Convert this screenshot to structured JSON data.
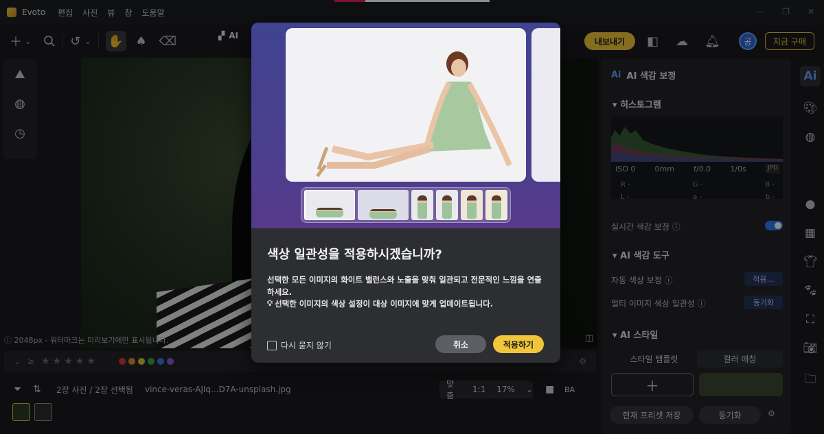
{
  "app": {
    "name": "Evoto",
    "menu": [
      "편집",
      "사진",
      "뷰",
      "창",
      "도움말"
    ]
  },
  "toolbar": {
    "ai_label": "AI",
    "export_label": "내보내기",
    "avatar_initial": "공",
    "buy_label": "지금 구매"
  },
  "canvas": {
    "watermark_info": "ⓘ 2048px - 워터마크는 미리보기에만 표시됩니다."
  },
  "filmbar": {
    "rating_op": "≥",
    "stars": "★★★★★",
    "color_dots": [
      "#d23a3a",
      "#e08a2a",
      "#d8c83a",
      "#3aa84a",
      "#3a7ad8",
      "#8a5ad8"
    ],
    "count": "2장 사진 / 2장 선택됨",
    "filename": "vince-veras-AJIq...D7A-unsplash.jpg",
    "fit_label": "맞춤",
    "ratio_label": "1:1",
    "zoom_label": "17%"
  },
  "panel": {
    "title": "AI 색감 보정",
    "histogram": {
      "title": "히스토그램",
      "iso": "ISO 0",
      "mm": "0mm",
      "f": "f/0.0",
      "shutter": "1/0s",
      "format": "JPG",
      "r": "R -",
      "g": "G -",
      "b": "B -",
      "l": "L -",
      "a": "a -",
      "b2": "b -"
    },
    "realtime_label": "실시간 색감 보정 ⓘ",
    "tools_title": "AI 색감 도구",
    "auto_label": "자동 색상 보정 ⓘ",
    "auto_btn": "적용…",
    "multi_label": "멀티 이미지 색상 일관성 ⓘ",
    "multi_btn": "동기화",
    "style_title": "AI 스타일",
    "tab_template": "스타일 템플릿",
    "tab_match": "컬러 매칭",
    "save_preset": "현재 프리셋 저장",
    "sync": "동기화"
  },
  "modal": {
    "title": "색상 일관성을 적용하시겠습니까?",
    "desc": "선택한 모든 이미지의 화이트 밸런스와 노출을 맞춰 일관되고 전문적인 느낌을 연출하세요.",
    "tip": "선택한 이미지의 색상 설정이 대상 이미지에 맞게 업데이트됩니다.",
    "dont_ask": "다시 묻지 않기",
    "cancel": "취소",
    "apply": "적용하기"
  }
}
